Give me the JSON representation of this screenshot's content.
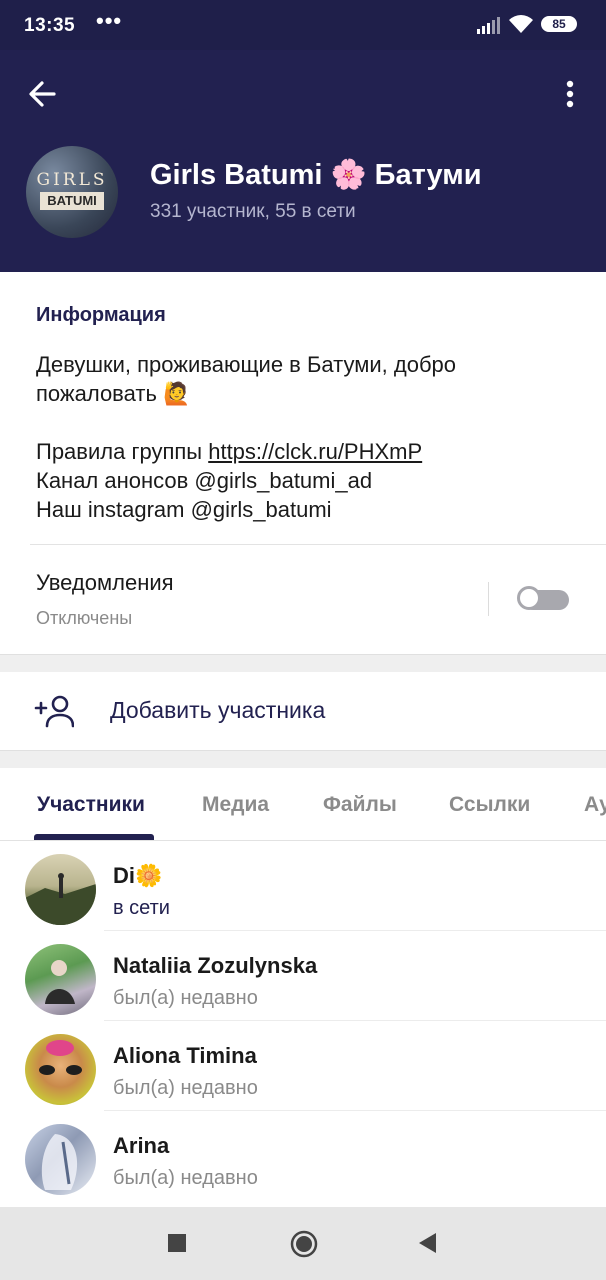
{
  "status_bar": {
    "time": "13:35",
    "dots": "•••",
    "battery": "85"
  },
  "header": {
    "title": "Girls Batumi 🌸 Батуми",
    "subtitle": "331 участник, 55 в сети",
    "avatar_text_top": "GIRLS",
    "avatar_text_bottom": "BATUMI",
    "background_color": "#222150"
  },
  "info": {
    "heading": "Информация",
    "description": "Девушки, проживающие в Батуми, добро пожаловать 🙋",
    "rules_label": "Правила группы ",
    "rules_link": "https://clck.ru/PHXmP",
    "channel": "Канал анонсов @girls_batumi_ad",
    "instagram": "Наш instagram @girls_batumi"
  },
  "notifications": {
    "title": "Уведомления",
    "status": "Отключены",
    "enabled": false
  },
  "add_member": {
    "label": "Добавить участника"
  },
  "tabs": [
    {
      "label": "Участники",
      "active": true
    },
    {
      "label": "Медиа",
      "active": false
    },
    {
      "label": "Файлы",
      "active": false
    },
    {
      "label": "Ссылки",
      "active": false
    },
    {
      "label": "Ау",
      "active": false
    }
  ],
  "members": [
    {
      "name": "Di🌼",
      "status": "в сети",
      "online": true
    },
    {
      "name": "Nataliia Zozulynska",
      "status": "был(а) недавно",
      "online": false
    },
    {
      "name": "Aliona Timina",
      "status": "был(а) недавно",
      "online": false
    },
    {
      "name": "Arina",
      "status": "был(а) недавно",
      "online": false
    }
  ],
  "colors": {
    "accent": "#222150",
    "muted_text": "#8a8a8a",
    "toggle_off": "#a8a8ae"
  }
}
